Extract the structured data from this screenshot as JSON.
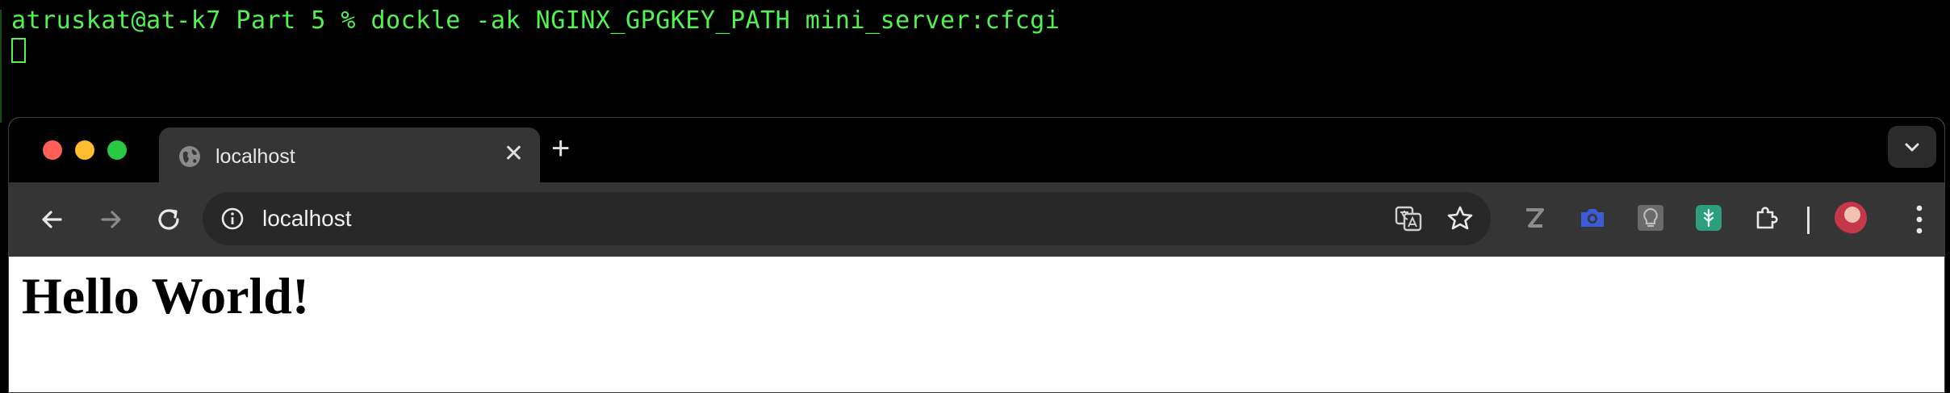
{
  "terminal": {
    "prompt_line": "atruskat@at-k7 Part 5 % dockle -ak NGINX_GPGKEY_PATH mini_server:cfcgi"
  },
  "browser": {
    "tab": {
      "title": "localhost",
      "icon": "globe-icon"
    },
    "toolbar": {
      "url": "localhost"
    },
    "colors": {
      "tabstrip": "#000000",
      "toolbar": "#353535",
      "omnibox": "#282828",
      "accent_blue": "#3b5bd9",
      "extension_teal": "#2e9e7e"
    }
  },
  "page": {
    "heading": "Hello World!"
  }
}
